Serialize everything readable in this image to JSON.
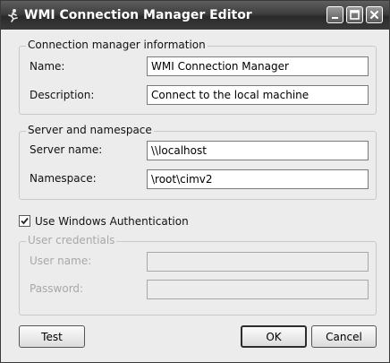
{
  "window": {
    "title": "WMI Connection Manager Editor"
  },
  "connection_info": {
    "group_label": "Connection manager information",
    "name_label": "Name:",
    "name_value": "WMI Connection Manager",
    "description_label": "Description:",
    "description_value": "Connect to the local machine"
  },
  "server": {
    "group_label": "Server and namespace",
    "server_label": "Server name:",
    "server_value": "\\\\localhost",
    "namespace_label": "Namespace:",
    "namespace_value": "\\root\\cimv2"
  },
  "auth": {
    "checkbox_label": "Use Windows Authentication",
    "checked": true
  },
  "credentials": {
    "group_label": "User credentials",
    "username_label": "User name:",
    "username_value": "",
    "password_label": "Password:",
    "password_value": ""
  },
  "buttons": {
    "test": "Test",
    "ok": "OK",
    "cancel": "Cancel"
  },
  "icons": {
    "app": "wmi-connection-icon",
    "minimize": "minimize-icon",
    "maximize": "maximize-icon",
    "close": "close-icon",
    "check": "checkmark-icon"
  }
}
